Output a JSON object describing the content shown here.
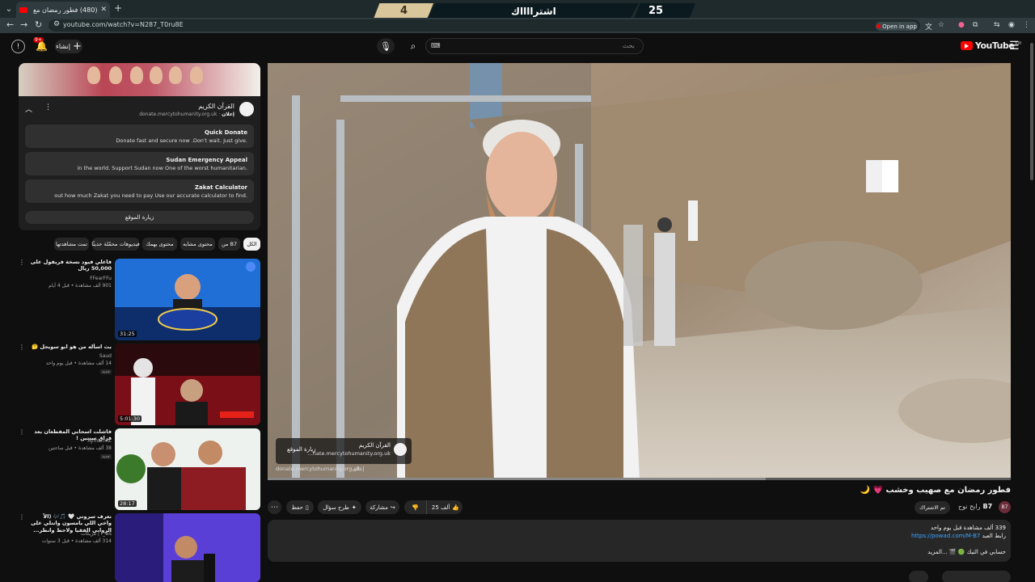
{
  "browser": {
    "tab_title": "(480) فطور رمضان مع صهيب",
    "url": "youtube.com/watch?v=N287_T0ru8E",
    "open_in_app": "Open in app"
  },
  "scoreboard": {
    "left_score": "4",
    "center_text": "اشترااااك",
    "right_score": "25"
  },
  "header": {
    "logo_text": "YouTube",
    "logo_region": "KW",
    "search_placeholder": "بحث",
    "search_keyboard": "⌨",
    "create_label": "إنشاء",
    "notifications_badge": "9+"
  },
  "player": {
    "ad_card": {
      "name": "القرآن الكريم",
      "url": "...nate.mercytohumanity.org.uk",
      "visit": "زيارة الموقع",
      "under_url": "donate.mercytohumanity.org.uk",
      "under_badge": "إعلان"
    },
    "progress_played": 0.0,
    "progress_buffered": 0.67
  },
  "video": {
    "title": "فطور رمضان مع صهيب وخشب 💗 🌙",
    "channel_name": "B7",
    "channel_sub": "رابح نوح",
    "channel_avatar": "B7",
    "subscribed_label": "تم الاشتراك",
    "likes": "25 ألف",
    "share_label": "مشاركة",
    "remix_label": "طرح سؤال",
    "save_label": "حفظ"
  },
  "description": {
    "line1": "339 ألف مشاهدة  قبل يوم واحد",
    "line2_prefix": "رابط العبد",
    "line2_link": "https://powad.com/M-B7",
    "line3": "حسابي في التيك 🟢 🎬 ...المزيد"
  },
  "sidebar_ad": {
    "sponsor_name": "القرآن الكريم",
    "sponsor_label": "إعلان",
    "sponsor_url": "donate.mercytohumanity.org.uk",
    "sitelinks": [
      {
        "title": "Quick Donate",
        "desc": "Donate fast and secure now .Don't wait. Just give."
      },
      {
        "title": "Sudan Emergency Appeal",
        "desc": "in the world. Support Sudan now One of the worst humanitarian."
      },
      {
        "title": "Zakat Calculator",
        "desc": "out how much Zakat you need to pay Use our accurate calculator to find."
      }
    ],
    "visit_label": "زيارة الموقع"
  },
  "chips": [
    "الكل",
    "من B7",
    "محتوى مشابه",
    "محتوى يهمك",
    "فيديوهات محمّلة حديثًا",
    "تمت مشاهدتها"
  ],
  "recommended": [
    {
      "title": "فاعلي فيود نسخة فريقول على 50,000 ريال",
      "channel": "FFearFFu",
      "meta": "901 ألف مشاهدة • قبل 4 أيام",
      "duration": "31:25",
      "thumb_text": "FRL FEUD",
      "badge": ""
    },
    {
      "title": "بث اسأله من هو ابو سويحل 🤔",
      "channel": "Saud",
      "meta": "14 ألف مشاهدة • قبل يوم واحد",
      "duration": "5:01:30",
      "thumb_text": "من هو أبو سويحل",
      "badge": "جديد"
    },
    {
      "title": "فاشلت اسحابي المقطعان بعد فراق سنتين !",
      "channel": "Ayman Ac",
      "meta": "38 ألف مشاهدة • قبل ساعتين",
      "duration": "28:17",
      "thumb_text": "",
      "badge": "جديد"
    },
    {
      "title": "نعرف سروتي 🤍 🎵🎶 (الآ واخي اللي يامسون وانتلي على الروابي الفقيا ولاحظ وانظر...",
      "channel": "f_ws | مزيكات",
      "meta": "314 ألف مشاهدة • قبل 3 سنوات",
      "duration": "",
      "thumb_text": "",
      "badge": ""
    }
  ]
}
